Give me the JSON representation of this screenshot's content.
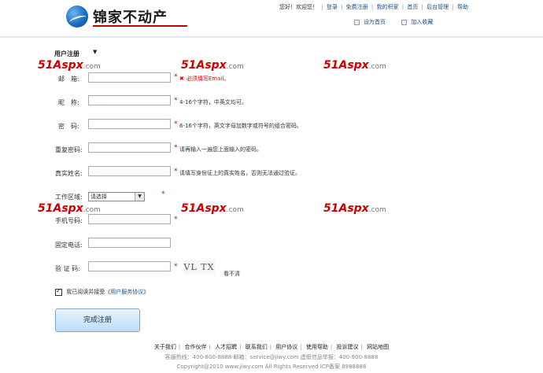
{
  "header": {
    "logo_text": "锦家不动产",
    "greeting": "您好！欢迎您！",
    "nav": [
      "登录",
      "免费注册",
      "我的积家",
      "首页",
      "后台管理",
      "帮助"
    ],
    "subnav": [
      "设为首页",
      "加入收藏"
    ]
  },
  "watermark": {
    "main": "51Aspx",
    "tail": ".com"
  },
  "form": {
    "section_title": "用户注册",
    "section_arrow": "▼",
    "email": {
      "label": "邮　箱:",
      "value": "",
      "error": "必须填写Email。"
    },
    "nickname": {
      "label": "昵　称:",
      "value": "",
      "hint": "4-16个字符，中英文均可。"
    },
    "password": {
      "label": "密　码:",
      "value": "",
      "hint": "6-16个字符，英文字母加数字或符号的组合密码。"
    },
    "confirm": {
      "label": "重复密码:",
      "value": "",
      "hint": "请再输入一遍您上面输入的密码。"
    },
    "realname": {
      "label": "真实姓名:",
      "value": "",
      "hint": "请填写身份证上的真实姓名，否则无法通过验证。"
    },
    "region": {
      "label": "工作区域:",
      "selected": "请选择"
    },
    "mobile": {
      "label": "手机号码:",
      "value": ""
    },
    "phone": {
      "label": "固定电话:",
      "value": ""
    },
    "captcha": {
      "label": "验 证 码:",
      "value": "",
      "image_text": "VL TX",
      "refresh": "看不清"
    },
    "star": "*",
    "agree_text": "我已阅读并接受",
    "agree_link": "《用户服务协议》",
    "submit_label": "完成注册"
  },
  "footer": {
    "links": [
      "关于我们",
      "合作伙伴",
      "人才招聘",
      "联系我们",
      "用户协议",
      "使用帮助",
      "投诉建议",
      "网站地图"
    ],
    "contact": "客服热线：400-800-8888 邮箱：service@jiwy.com 虚假信息举报：400-800-8888",
    "copyright": "Copyright@2010 www.jiwy.com All Rights Reserved ICP备案 8988888"
  }
}
